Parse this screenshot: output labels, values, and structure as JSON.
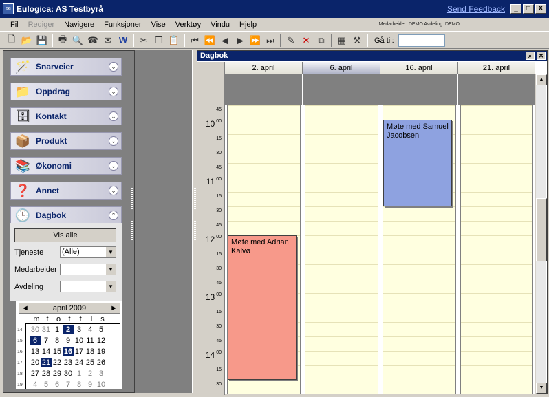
{
  "window": {
    "title": "Eulogica: AS Testbyrå",
    "feedback": "Send Feedback",
    "min": "_",
    "max": "□",
    "close": "X"
  },
  "menu": {
    "items": [
      "Fil",
      "Rediger",
      "Navigere",
      "Funksjoner",
      "Vise",
      "Verktøy",
      "Vindu",
      "Hjelp"
    ],
    "info": "Medarbeider: DEMO   Avdeling: DEMO"
  },
  "toolbar": {
    "goto_label": "Gå til:",
    "goto_value": ""
  },
  "sidebar": {
    "sections": [
      {
        "label": "Snarveier",
        "icon": "wand-icon"
      },
      {
        "label": "Oppdrag",
        "icon": "folder-icon"
      },
      {
        "label": "Kontakt",
        "icon": "cabinet-icon"
      },
      {
        "label": "Produkt",
        "icon": "box-icon"
      },
      {
        "label": "Økonomi",
        "icon": "books-icon"
      },
      {
        "label": "Annet",
        "icon": "question-folder-icon"
      },
      {
        "label": "Dagbok",
        "icon": "clock-folder-icon"
      }
    ],
    "dagbok": {
      "vis_alle": "Vis alle",
      "tjeneste_label": "Tjeneste",
      "tjeneste_value": "(Alle)",
      "medarbeider_label": "Medarbeider",
      "medarbeider_value": "",
      "avdeling_label": "Avdeling",
      "avdeling_value": ""
    }
  },
  "calendar": {
    "month": "april 2009",
    "prev": "◄",
    "next": "►",
    "weekdays": [
      "m",
      "t",
      "o",
      "t",
      "f",
      "l",
      "s"
    ],
    "weeks": [
      {
        "wk": "14",
        "days": [
          "30",
          "31",
          "1",
          "2",
          "3",
          "4",
          "5"
        ]
      },
      {
        "wk": "15",
        "days": [
          "6",
          "7",
          "8",
          "9",
          "10",
          "11",
          "12"
        ]
      },
      {
        "wk": "16",
        "days": [
          "13",
          "14",
          "15",
          "16",
          "17",
          "18",
          "19"
        ]
      },
      {
        "wk": "17",
        "days": [
          "20",
          "21",
          "22",
          "23",
          "24",
          "25",
          "26"
        ]
      },
      {
        "wk": "18",
        "days": [
          "27",
          "28",
          "29",
          "30",
          "1",
          "2",
          "3"
        ]
      },
      {
        "wk": "19",
        "days": [
          "4",
          "5",
          "6",
          "7",
          "8",
          "9",
          "10"
        ]
      }
    ]
  },
  "dagbok": {
    "title": "Dagbok",
    "columns": [
      "2. april",
      "6. april",
      "16. april",
      "21. april"
    ],
    "times": [
      {
        "t": "45"
      },
      {
        "t": "10",
        "h": true
      },
      {
        "t": "15"
      },
      {
        "t": "30"
      },
      {
        "t": "45"
      },
      {
        "t": "11",
        "h": true
      },
      {
        "t": "15"
      },
      {
        "t": "30"
      },
      {
        "t": "45"
      },
      {
        "t": "12",
        "h": true
      },
      {
        "t": "15"
      },
      {
        "t": "30"
      },
      {
        "t": "45"
      },
      {
        "t": "13",
        "h": true
      },
      {
        "t": "15"
      },
      {
        "t": "30"
      },
      {
        "t": "45"
      },
      {
        "t": "14",
        "h": true
      },
      {
        "t": "15"
      },
      {
        "t": "30"
      }
    ],
    "hour_suffix": "00",
    "appointments": [
      {
        "title": "Møte med Samuel Jacobsen",
        "column": 2,
        "start": "10:00",
        "end": "11:30",
        "color": "#8ea2e0"
      },
      {
        "title": "Møte med Adrian Kalvø",
        "column": 0,
        "start": "12:00",
        "end": "14:30",
        "color": "#f7998a"
      }
    ]
  }
}
